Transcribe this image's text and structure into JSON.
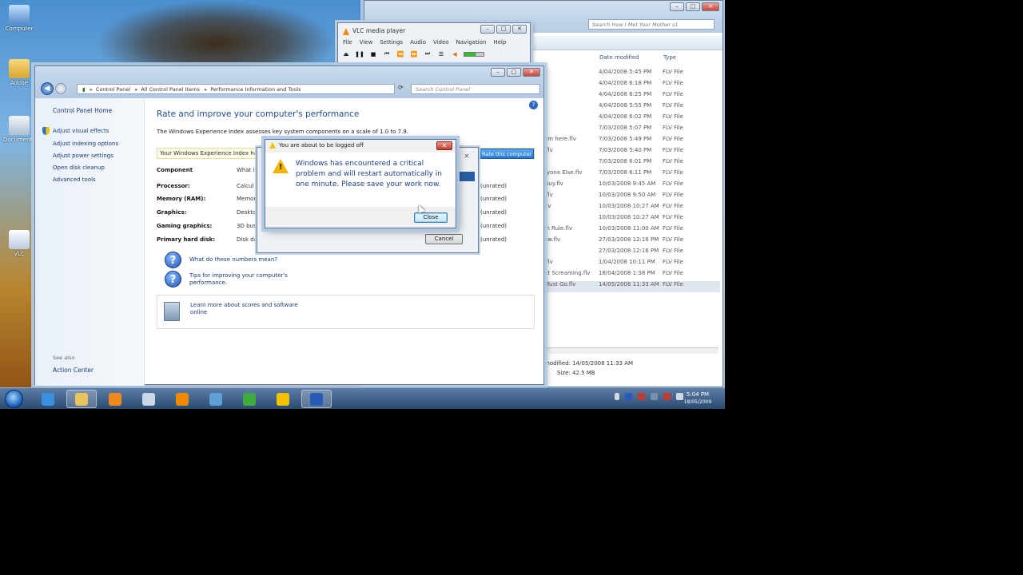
{
  "desktop": {
    "icons": [
      {
        "label": "Computer",
        "icon": "computer-icon",
        "color": "#6fa3d8"
      },
      {
        "label": "Adobe",
        "icon": "folder-icon",
        "color": "#e2b94a"
      },
      {
        "label": "Documents",
        "icon": "documents-icon",
        "color": "#cfd9e6"
      },
      {
        "label": "VLC",
        "icon": "shortcut-icon",
        "color": "#d7e3f0"
      }
    ]
  },
  "vlc": {
    "title": "VLC media player",
    "menu": [
      "File",
      "View",
      "Settings",
      "Audio",
      "Video",
      "Navigation",
      "Help"
    ],
    "controls": [
      "eject",
      "pause",
      "stop",
      "previous",
      "rewind",
      "forward",
      "next",
      "playlist"
    ],
    "volume_level": 0.6
  },
  "explorer": {
    "search_placeholder": "Search How I Met Your Mother s1",
    "columns": [
      "Date modified",
      "Type"
    ],
    "files": [
      {
        "name": "",
        "date": "4/04/2008 5:45 PM",
        "type": "FLV File"
      },
      {
        "name": "",
        "date": "4/04/2008 6:18 PM",
        "type": "FLV File"
      },
      {
        "name": "",
        "date": "4/04/2008 6:25 PM",
        "type": "FLV File"
      },
      {
        "name": "",
        "date": "4/04/2008 5:55 PM",
        "type": "FLV File"
      },
      {
        "name": "",
        "date": "4/04/2008 6:02 PM",
        "type": "FLV File"
      },
      {
        "name": "",
        "date": "7/03/2008 5:07 PM",
        "type": "FLV File"
      },
      {
        "name": "om here.flv",
        "date": "7/03/2008 5:49 PM",
        "type": "FLV File"
      },
      {
        "name": ".flv",
        "date": "7/03/2008 5:40 PM",
        "type": "FLV File"
      },
      {
        "name": "",
        "date": "7/03/2008 6:01 PM",
        "type": "FLV File"
      },
      {
        "name": "ryone Else.flv",
        "date": "7/03/2008 6:11 PM",
        "type": "FLV File"
      },
      {
        "name": "Guy.flv",
        "date": "10/03/2008 9:45 AM",
        "type": "FLV File"
      },
      {
        "name": ".flv",
        "date": "10/03/2008 9:50 AM",
        "type": "FLV File"
      },
      {
        "name": "flv",
        "date": "10/03/2008 10:27 AM",
        "type": "FLV File"
      },
      {
        "name": "",
        "date": "10/03/2008 10:27 AM",
        "type": "FLV File"
      },
      {
        "name": "m Rule.flv",
        "date": "10/03/2008 11:00 AM",
        "type": "FLV File"
      },
      {
        "name": "ow.flv",
        "date": "27/03/2008 12:16 PM",
        "type": "FLV File"
      },
      {
        "name": "",
        "date": "27/03/2008 12:16 PM",
        "type": "FLV File"
      },
      {
        "name": ".flv",
        "date": "1/04/2008 10:11 PM",
        "type": "FLV File"
      },
      {
        "name": "ut Screaming.flv",
        "date": "18/04/2008 1:38 PM",
        "type": "FLV File"
      },
      {
        "name": "Must Go.flv",
        "date": "14/05/2008 11:33 AM",
        "type": "FLV File",
        "selected": true
      }
    ],
    "details_modified": "modified: 14/05/2008 11:33 AM",
    "details_size": "Size: 42.5 MB"
  },
  "control_panel": {
    "address": [
      "Control Panel",
      "All Control Panel Items",
      "Performance Information and Tools"
    ],
    "search_placeholder": "Search Control Panel",
    "sidebar_home": "Control Panel Home",
    "sidebar_tasks": [
      "Adjust visual effects",
      "Adjust indexing options",
      "Adjust power settings",
      "Open disk cleanup",
      "Advanced tools"
    ],
    "see_also": "See also",
    "action_center": "Action Center",
    "heading": "Rate and improve your computer's performance",
    "intro": "The Windows Experience Index assesses key system components on a scale of 1.0 to 7.9.",
    "wei_text": "Your Windows Experience Index has",
    "rate_button": "Rate this computer",
    "component_header": "Component",
    "what_header": "What is",
    "components": [
      {
        "name": "Processor:",
        "what": "Calcul",
        "score": "(unrated)"
      },
      {
        "name": "Memory (RAM):",
        "what": "Memor",
        "score": "(unrated)"
      },
      {
        "name": "Graphics:",
        "what": "Desktop",
        "score": "(unrated)"
      },
      {
        "name": "Gaming graphics:",
        "what": "3D bus",
        "score": "(unrated)"
      },
      {
        "name": "Primary hard disk:",
        "what": "Disk dat",
        "score": "(unrated)"
      }
    ],
    "links": [
      "What do these numbers mean?",
      "Tips for improving your computer's performance.",
      "Learn more about scores and software online"
    ]
  },
  "background_dialog": {
    "cancel_label": "Cancel"
  },
  "alert": {
    "title": "You are about to be logged off",
    "message": "Windows has encountered a critical problem and will restart automatically in one minute. Please save your work now.",
    "close_label": "Close"
  },
  "taskbar": {
    "apps": [
      {
        "icon": "internet-explorer-icon",
        "color": "#3a8fe0"
      },
      {
        "icon": "windows-explorer-icon",
        "color": "#e9c35b",
        "active": true
      },
      {
        "icon": "media-player-icon",
        "color": "#f08a1c"
      },
      {
        "icon": "document-icon",
        "color": "#cad7e6"
      },
      {
        "icon": "vlc-icon",
        "color": "#f08a00"
      },
      {
        "icon": "control-panel-icon",
        "color": "#5fa0d8"
      },
      {
        "icon": "chrome-icon",
        "color": "#3faa3f"
      },
      {
        "icon": "warning-icon",
        "color": "#f2c200"
      },
      {
        "icon": "performance-icon",
        "color": "#2a5ab8",
        "active": true
      }
    ],
    "clock_time": "5:04 PM",
    "clock_date": "18/05/2009"
  }
}
